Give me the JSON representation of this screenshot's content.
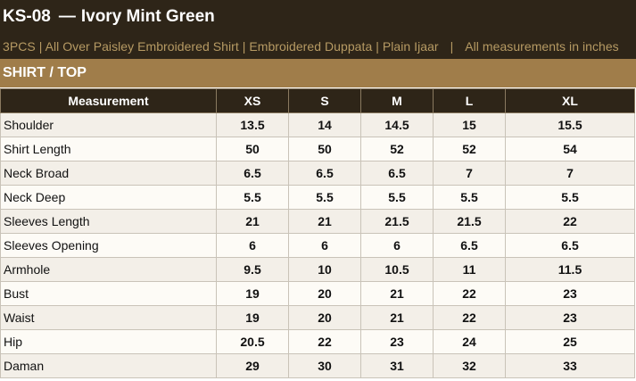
{
  "header": {
    "code": "KS-08",
    "separator": "—",
    "name": "Ivory Mint Green",
    "subtitle": "3PCS | All Over Paisley Embroidered Shirt | Embroidered Duppata | Plain Ijaar",
    "subtitle_separator": "|",
    "units_note": "All measurements in inches"
  },
  "section": {
    "title": "SHIRT / TOP"
  },
  "table": {
    "columns": [
      "Measurement",
      "XS",
      "S",
      "M",
      "L",
      "XL"
    ],
    "rows": [
      {
        "label": "Shoulder",
        "values": [
          "13.5",
          "14",
          "14.5",
          "15",
          "15.5"
        ]
      },
      {
        "label": "Shirt Length",
        "values": [
          "50",
          "50",
          "52",
          "52",
          "54"
        ]
      },
      {
        "label": "Neck Broad",
        "values": [
          "6.5",
          "6.5",
          "6.5",
          "7",
          "7"
        ]
      },
      {
        "label": "Neck Deep",
        "values": [
          "5.5",
          "5.5",
          "5.5",
          "5.5",
          "5.5"
        ]
      },
      {
        "label": "Sleeves Length",
        "values": [
          "21",
          "21",
          "21.5",
          "21.5",
          "22"
        ]
      },
      {
        "label": "Sleeves Opening",
        "values": [
          "6",
          "6",
          "6",
          "6.5",
          "6.5"
        ]
      },
      {
        "label": "Armhole",
        "values": [
          "9.5",
          "10",
          "10.5",
          "11",
          "11.5"
        ]
      },
      {
        "label": "Bust",
        "values": [
          "19",
          "20",
          "21",
          "22",
          "23"
        ]
      },
      {
        "label": "Waist",
        "values": [
          "19",
          "20",
          "21",
          "22",
          "23"
        ]
      },
      {
        "label": "Hip",
        "values": [
          "20.5",
          "22",
          "23",
          "24",
          "25"
        ]
      },
      {
        "label": "Daman",
        "values": [
          "29",
          "30",
          "31",
          "32",
          "33"
        ]
      }
    ]
  },
  "colors": {
    "header_bg": "#2e2518",
    "section_bg": "#a07d4a",
    "subtitle_text": "#b69a63",
    "row_odd": "#f3efe8",
    "row_even": "#fdfbf6"
  }
}
